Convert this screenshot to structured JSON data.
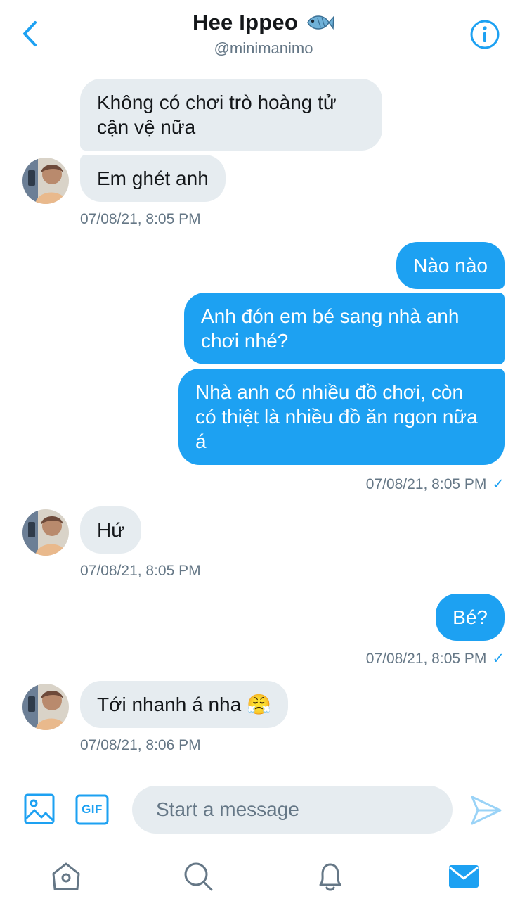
{
  "header": {
    "title": "Hee Ippeo",
    "handle": "@minimanimo"
  },
  "messages": {
    "in1_text": "Không có chơi trò hoàng tử cận vệ nữa",
    "in2_text": "Em ghét anh",
    "in2_time": "07/08/21, 8:05 PM",
    "out1_text": "Nào nào",
    "out2_text": "Anh đón em bé sang nhà anh chơi nhé?",
    "out3_text": "Nhà anh có nhiều đồ chơi, còn có thiệt là nhiều đồ ăn ngon nữa á",
    "out3_time": "07/08/21, 8:05 PM",
    "in3_text": "Hứ",
    "in3_time": "07/08/21, 8:05 PM",
    "out4_text": "Bé?",
    "out4_time": "07/08/21, 8:05 PM",
    "in4_text": "Tới nhanh á nha 😤",
    "in4_time": "07/08/21, 8:06 PM",
    "check": "✓"
  },
  "composer": {
    "placeholder": "Start a message",
    "gif_label": "GIF"
  },
  "tabs": [
    "home-icon",
    "search-icon",
    "notifications-icon",
    "messages-icon"
  ],
  "colors": {
    "accent": "#1da1f2",
    "bubble_in": "#e6ecf0",
    "muted": "#657786"
  }
}
